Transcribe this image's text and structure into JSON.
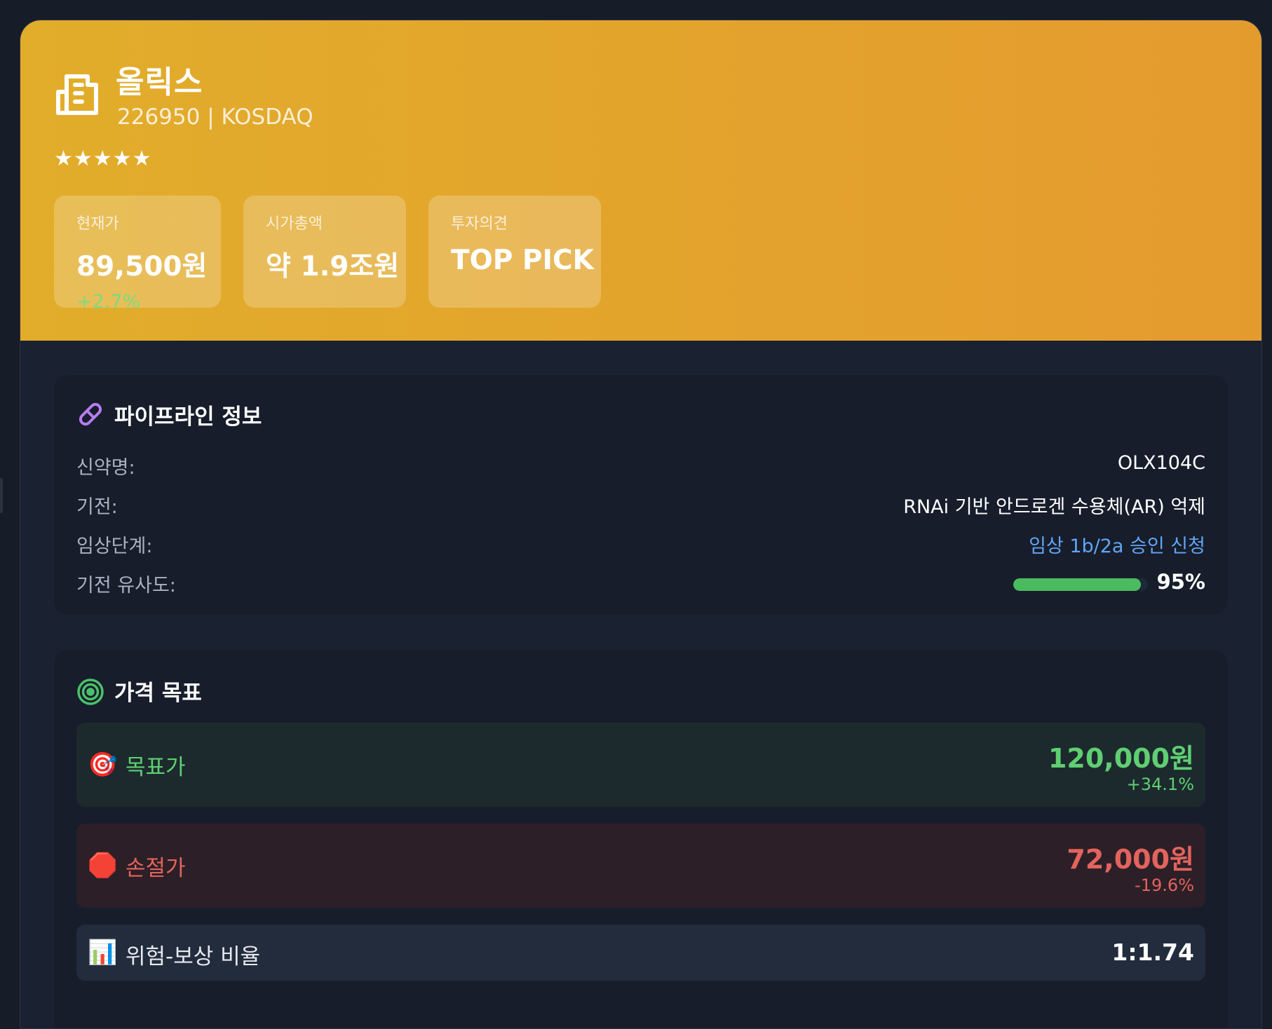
{
  "company": {
    "name": "올릭스",
    "code_market": "226950 | KOSDAQ",
    "stars": "★★★★★"
  },
  "stats": {
    "price_label": "현재가",
    "price_value": "89,500원",
    "price_change": "+2.7%",
    "cap_label": "시가총액",
    "cap_value": "약 1.9조원",
    "opinion_label": "투자의견",
    "opinion_value": "TOP PICK"
  },
  "pipeline": {
    "title": "파이프라인 정보",
    "icon": "pill-icon",
    "rows": [
      {
        "label": "신약명:",
        "value": "OLX104C"
      },
      {
        "label": "기전:",
        "value": "RNAi 기반 안드로겐 수용체(AR) 억제"
      },
      {
        "label": "임상단계:",
        "value": "임상 1b/2a 승인 신청"
      },
      {
        "label": "기전 유사도:",
        "value": "95%"
      }
    ],
    "similarity_fraction": 0.95
  },
  "targets": {
    "title": "가격 목표",
    "icon": "bullseye-icon",
    "target": {
      "emoji": "🎯",
      "label": "목표가",
      "price": "120,000원",
      "pct": "+34.1%"
    },
    "stoploss": {
      "emoji": "🛑",
      "label": "손절가",
      "price": "72,000원",
      "pct": "-19.6%"
    },
    "ratio": {
      "emoji": "📊",
      "label": "위험-보상 비율",
      "value": "1:1.74"
    }
  },
  "colors": {
    "header_gradient_start": "#e2ad2b",
    "header_gradient_end": "#e49b2e",
    "positive": "#5fcf72",
    "negative": "#e2645c",
    "link": "#62a5f4"
  }
}
